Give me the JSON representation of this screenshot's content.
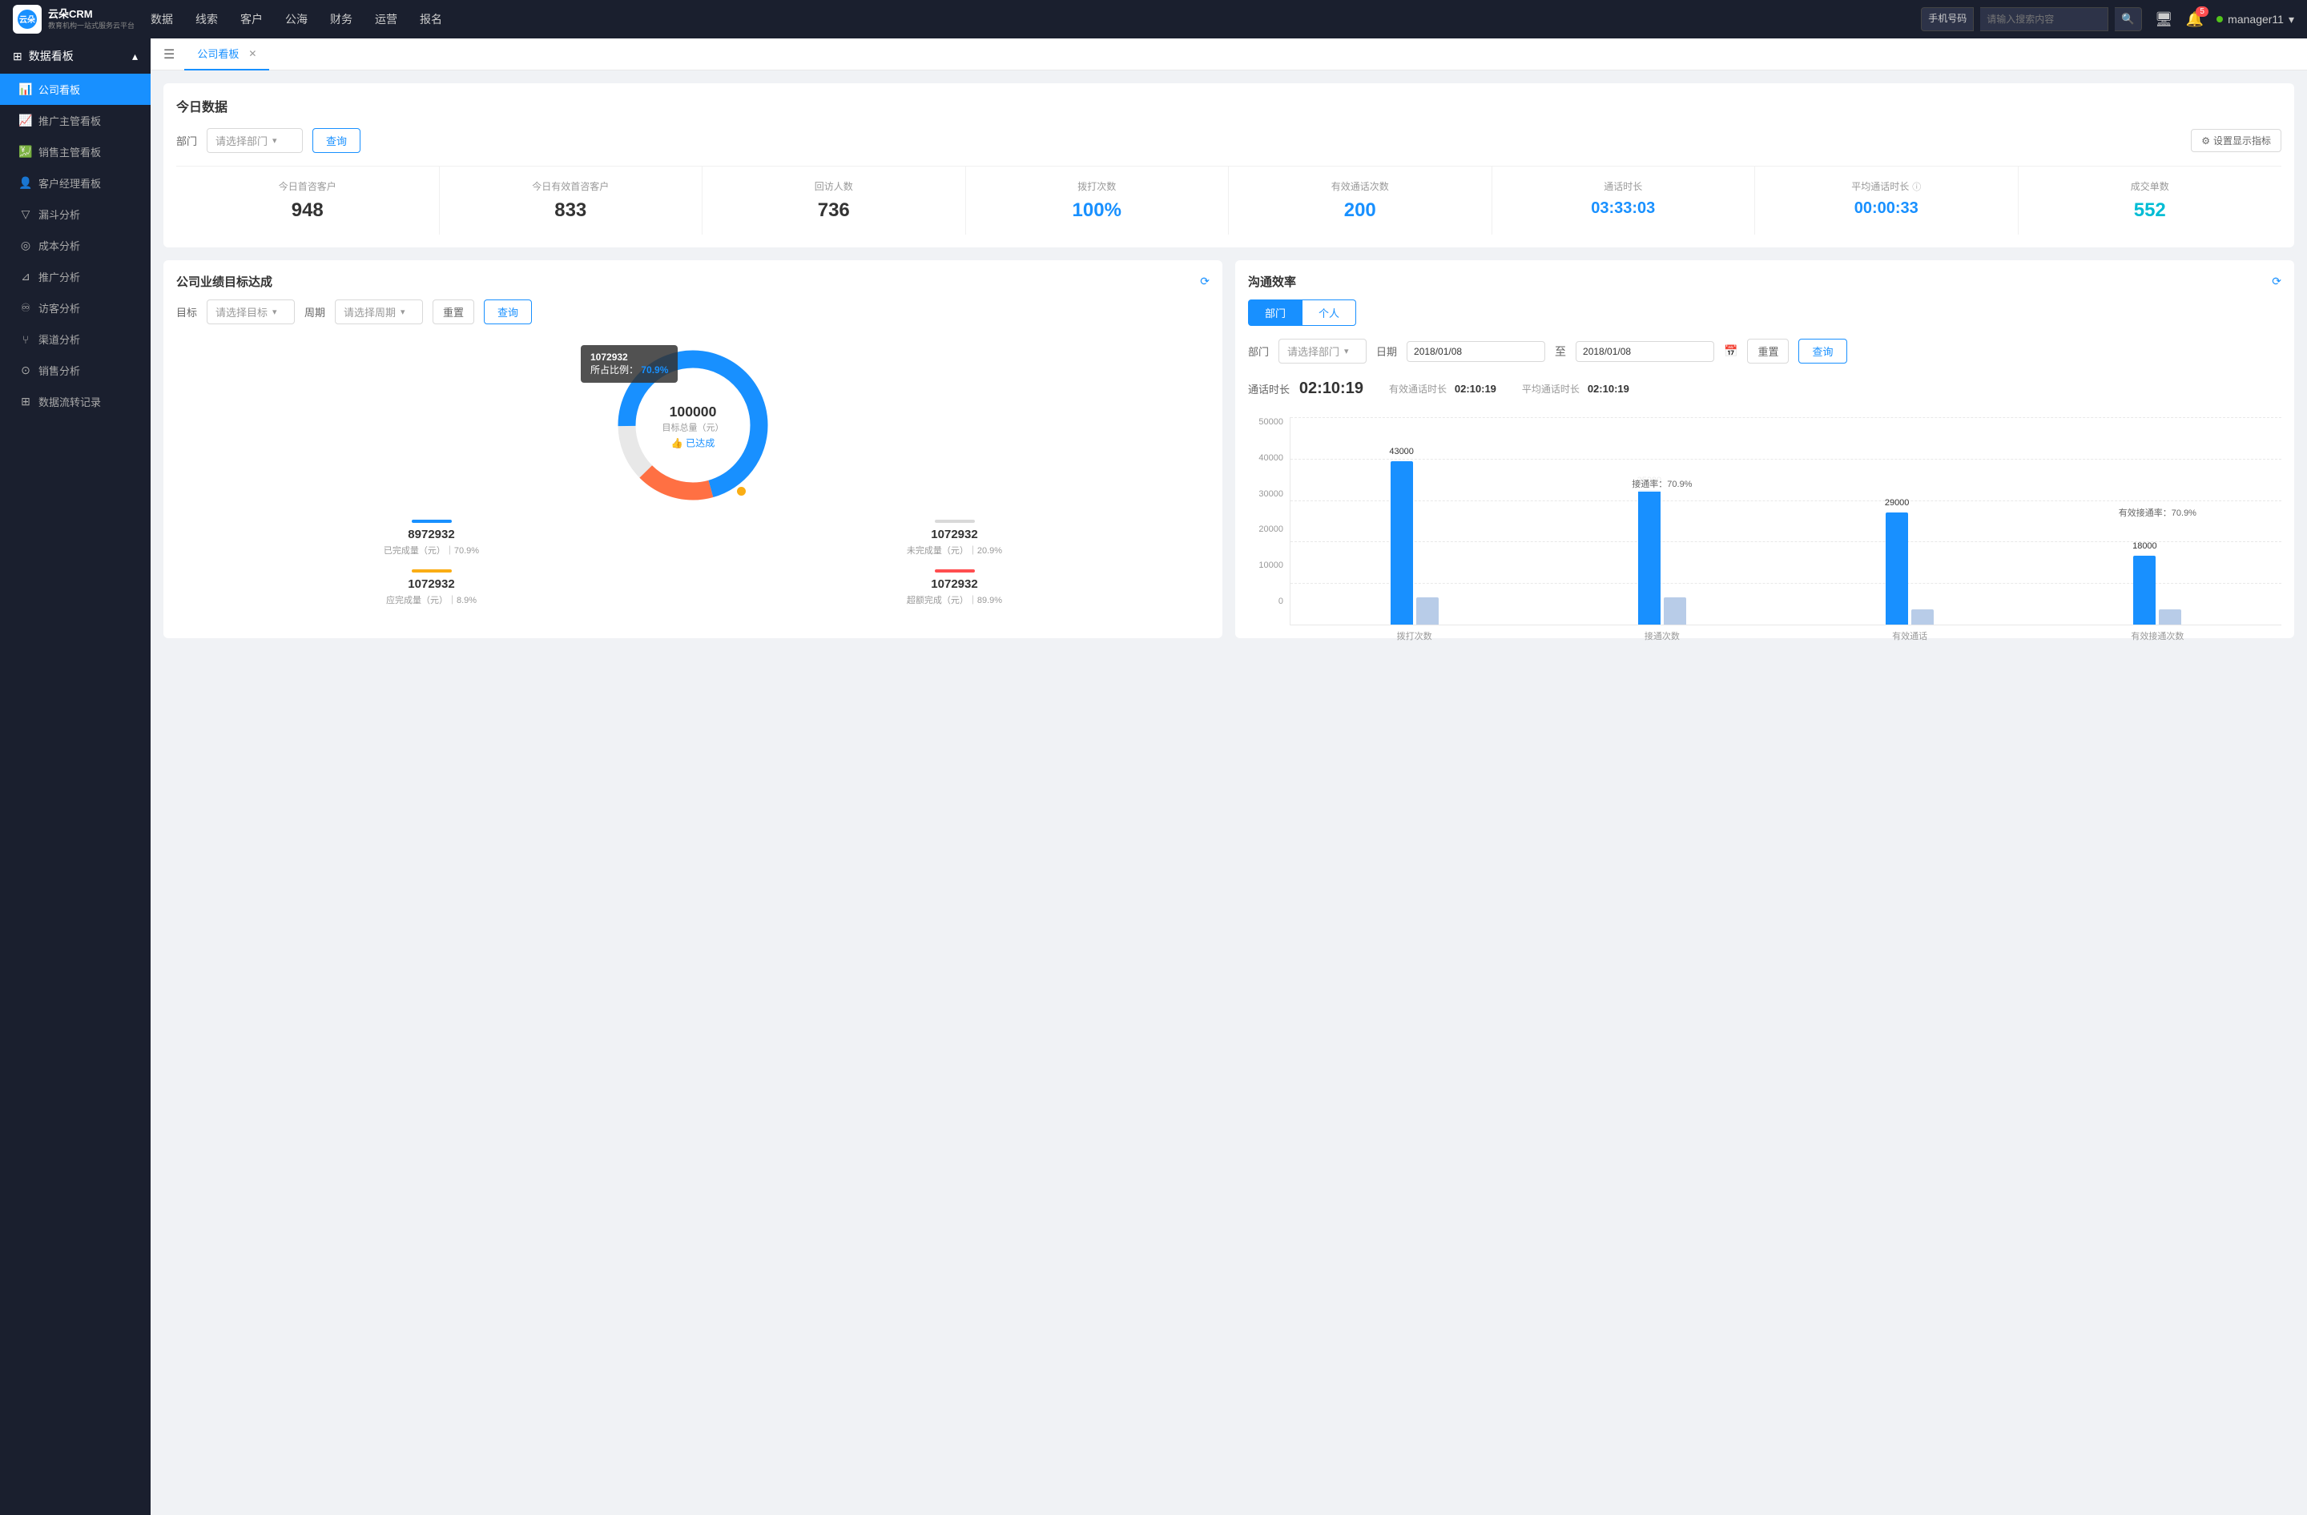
{
  "app": {
    "logo_text_line1": "云朵CRM",
    "logo_text_line2": "教育机构一站式服务云平台"
  },
  "topnav": {
    "items": [
      "数据",
      "线索",
      "客户",
      "公海",
      "财务",
      "运营",
      "报名"
    ],
    "search_placeholder": "请输入搜索内容",
    "search_type": "手机号码",
    "notification_count": "5",
    "username": "manager11"
  },
  "sidebar": {
    "section_title": "数据看板",
    "items": [
      {
        "label": "公司看板",
        "active": true,
        "icon": "📊"
      },
      {
        "label": "推广主管看板",
        "active": false,
        "icon": "📈"
      },
      {
        "label": "销售主管看板",
        "active": false,
        "icon": "💹"
      },
      {
        "label": "客户经理看板",
        "active": false,
        "icon": "👤"
      },
      {
        "label": "漏斗分析",
        "active": false,
        "icon": "⊽"
      },
      {
        "label": "成本分析",
        "active": false,
        "icon": "◎"
      },
      {
        "label": "推广分析",
        "active": false,
        "icon": "⊿"
      },
      {
        "label": "访客分析",
        "active": false,
        "icon": "♾"
      },
      {
        "label": "渠道分析",
        "active": false,
        "icon": "⑂"
      },
      {
        "label": "销售分析",
        "active": false,
        "icon": "⊙"
      },
      {
        "label": "数据流转记录",
        "active": false,
        "icon": "⊞"
      }
    ]
  },
  "tab_bar": {
    "tabs": [
      {
        "label": "公司看板",
        "active": true,
        "closeable": true
      }
    ]
  },
  "today_data": {
    "title": "今日数据",
    "filter": {
      "label": "部门",
      "placeholder": "请选择部门",
      "query_btn": "查询",
      "setting_btn": "设置显示指标"
    },
    "stats": [
      {
        "label": "今日首咨客户",
        "value": "948",
        "color": "black"
      },
      {
        "label": "今日有效首咨客户",
        "value": "833",
        "color": "black"
      },
      {
        "label": "回访人数",
        "value": "736",
        "color": "black"
      },
      {
        "label": "拨打次数",
        "value": "100%",
        "color": "blue"
      },
      {
        "label": "有效通话次数",
        "value": "200",
        "color": "blue"
      },
      {
        "label": "通话时长",
        "value": "03:33:03",
        "color": "blue"
      },
      {
        "label": "平均通话时长",
        "value": "00:00:33",
        "color": "blue"
      },
      {
        "label": "成交单数",
        "value": "552",
        "color": "cyan"
      }
    ]
  },
  "company_goal": {
    "title": "公司业绩目标达成",
    "filter": {
      "target_label": "目标",
      "target_placeholder": "请选择目标",
      "period_label": "周期",
      "period_placeholder": "请选择周期",
      "reset_btn": "重置",
      "query_btn": "查询"
    },
    "donut": {
      "center_value": "100000",
      "center_label": "目标总量（元）",
      "center_achieved": "已达成",
      "tooltip_value": "1072932",
      "tooltip_pct_label": "所占比例：",
      "tooltip_pct": "70.9%"
    },
    "chart_stats": [
      {
        "value": "8972932",
        "sub": "已完成量（元）｜70.9%",
        "color": "#1890ff"
      },
      {
        "value": "1072932",
        "sub": "未完成量（元）｜20.9%",
        "color": "#d9d9d9"
      },
      {
        "value": "1072932",
        "sub": "应完成量（元）｜8.9%",
        "color": "#faad14"
      },
      {
        "value": "1072932",
        "sub": "超额完成（元）｜89.9%",
        "color": "#ff4d4f"
      }
    ]
  },
  "communication": {
    "title": "沟通效率",
    "tabs": [
      "部门",
      "个人"
    ],
    "active_tab": 0,
    "filter": {
      "dept_label": "部门",
      "dept_placeholder": "请选择部门",
      "date_label": "日期",
      "date_from": "2018/01/08",
      "date_to": "2018/01/08",
      "reset_btn": "重置",
      "query_btn": "查询"
    },
    "summary": {
      "call_duration_label": "通话时长",
      "call_duration_value": "02:10:19",
      "effective_label": "有效通话时长",
      "effective_value": "02:10:19",
      "avg_label": "平均通话时长",
      "avg_value": "02:10:19"
    },
    "chart": {
      "y_labels": [
        "0",
        "10000",
        "20000",
        "30000",
        "40000",
        "50000"
      ],
      "groups": [
        {
          "x_label": "拨打次数",
          "bars": [
            {
              "value": 43000,
              "label": "43000",
              "color": "#1890ff",
              "height_pct": 86
            },
            {
              "value": 7000,
              "label": "",
              "color": "#b0c4de",
              "height_pct": 14
            }
          ],
          "annotation": ""
        },
        {
          "x_label": "接通次数",
          "bars": [
            {
              "value": 35000,
              "label": "35000",
              "color": "#1890ff",
              "height_pct": 70
            },
            {
              "value": 7000,
              "label": "",
              "color": "#b0c4de",
              "height_pct": 14
            }
          ],
          "annotation": "接通率：70.9%"
        },
        {
          "x_label": "有效通话",
          "bars": [
            {
              "value": 29000,
              "label": "29000",
              "color": "#1890ff",
              "height_pct": 58
            },
            {
              "value": 4000,
              "label": "",
              "color": "#b0c4de",
              "height_pct": 8
            }
          ],
          "annotation": ""
        },
        {
          "x_label": "有效接通次数",
          "bars": [
            {
              "value": 18000,
              "label": "18000",
              "color": "#1890ff",
              "height_pct": 36
            },
            {
              "value": 4000,
              "label": "",
              "color": "#b0c4de",
              "height_pct": 8
            }
          ],
          "annotation": "有效接通率：70.9%"
        }
      ]
    }
  }
}
